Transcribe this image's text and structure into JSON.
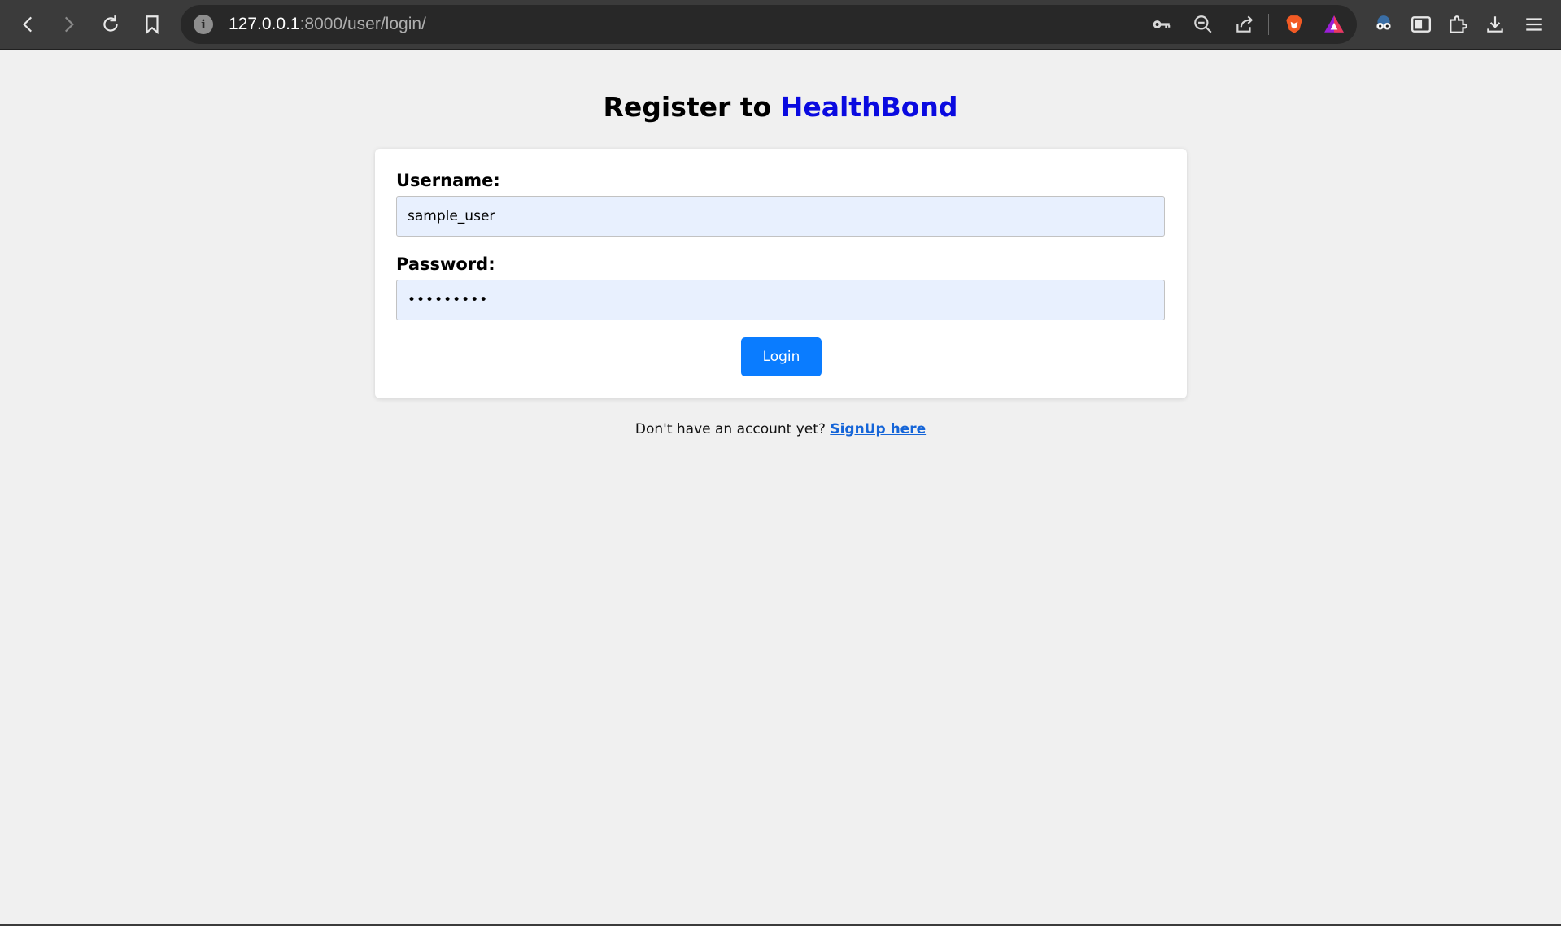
{
  "browser": {
    "url_host": "127.0.0.1",
    "url_rest": ":8000/user/login/",
    "icons": [
      "back-icon",
      "forward-icon",
      "reload-icon",
      "bookmark-icon",
      "site-info-icon",
      "key-icon",
      "zoom-out-icon",
      "share-icon",
      "brave-shields-icon",
      "brave-rewards-icon",
      "extension-glasses-icon",
      "sidebar-icon",
      "extensions-puzzle-icon",
      "download-icon",
      "menu-icon"
    ]
  },
  "page": {
    "title_prefix": "Register to ",
    "title_brand": "HealthBond",
    "brand_color": "#0a0ae0"
  },
  "form": {
    "username_label": "Username:",
    "username_value": "sample_user",
    "password_label": "Password:",
    "password_mask": "•••••••••",
    "login_label": "Login",
    "button_color": "#0a7cff"
  },
  "footer": {
    "prompt": "Don't have an account yet? ",
    "signup_link": "SignUp here"
  }
}
